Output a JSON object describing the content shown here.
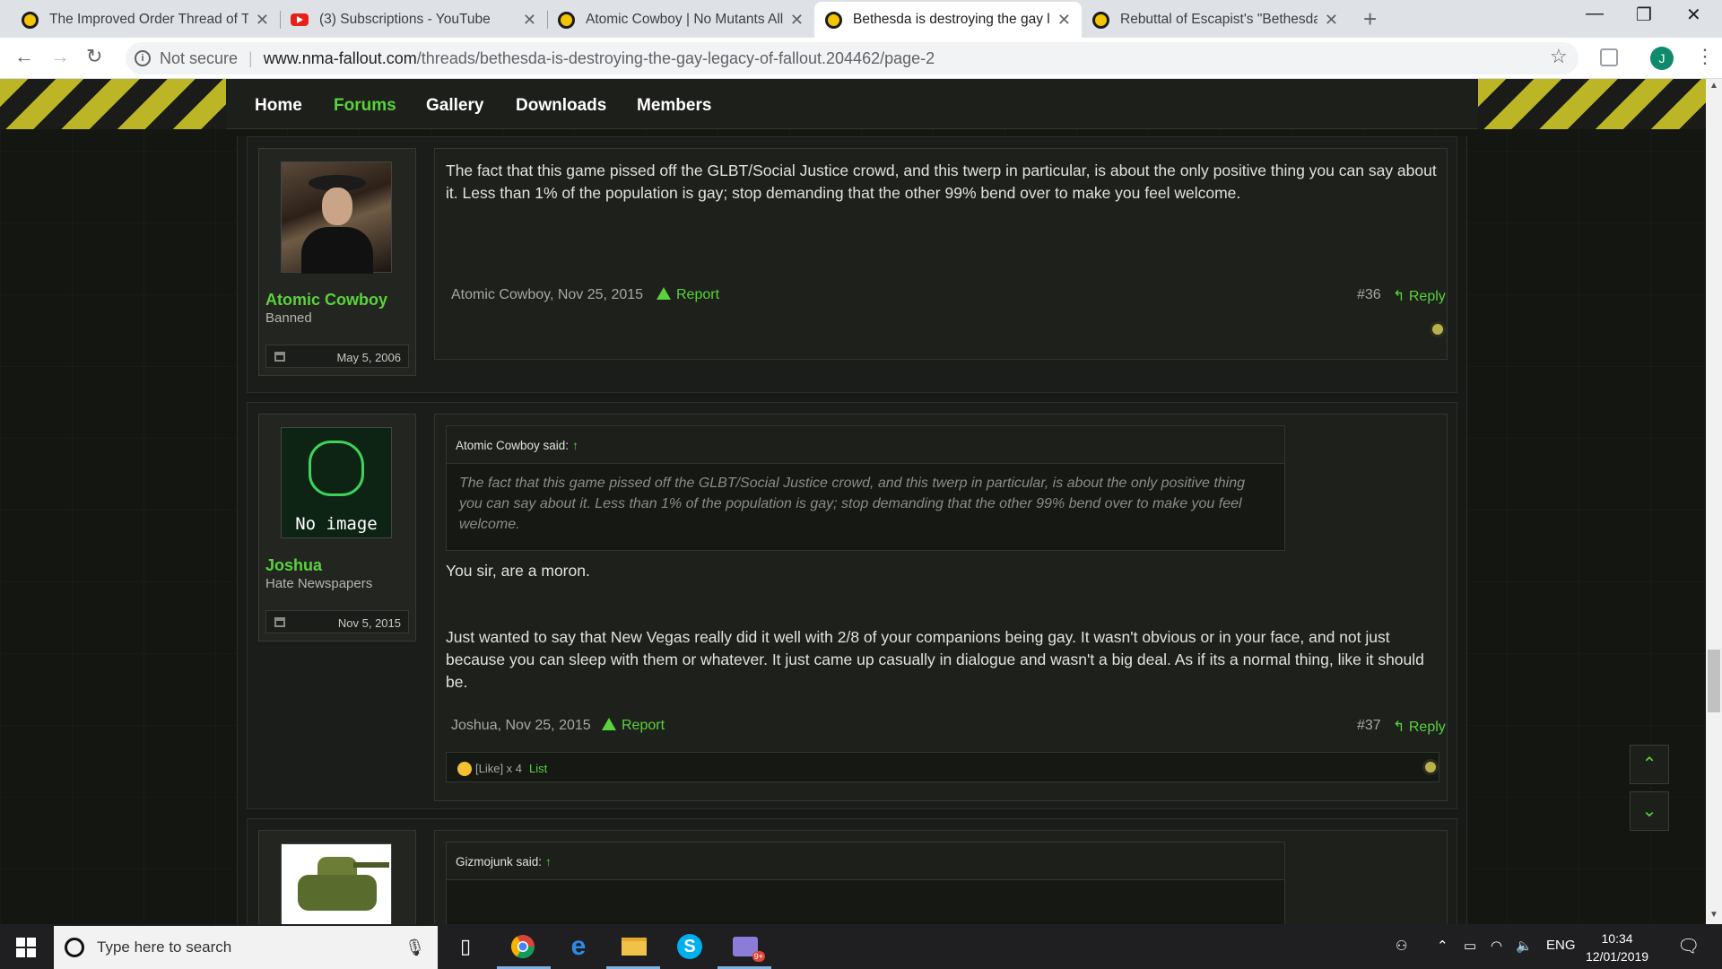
{
  "browser": {
    "tabs": [
      {
        "title": "The Improved Order Thread of Ti",
        "icon": "nma-favicon"
      },
      {
        "title": "(3) Subscriptions - YouTube",
        "icon": "youtube-favicon"
      },
      {
        "title": "Atomic Cowboy | No Mutants All",
        "icon": "nma-favicon"
      },
      {
        "title": "Bethesda is destroying the gay le",
        "icon": "nma-favicon",
        "active": true
      },
      {
        "title": "Rebuttal of Escapist's \"Bethesda i",
        "icon": "nma-favicon"
      }
    ],
    "address": {
      "security": "Not secure",
      "host": "www.nma-fallout.com",
      "path": "/threads/bethesda-is-destroying-the-gay-legacy-of-fallout.204462/page-2"
    },
    "profile_initial": "J"
  },
  "site": {
    "nav": [
      "Home",
      "Forums",
      "Gallery",
      "Downloads",
      "Members"
    ],
    "active_nav": "Forums"
  },
  "posts": [
    {
      "author": "Atomic Cowboy",
      "user_title": "Banned",
      "join_date": "May 5, 2006",
      "avatar": "photo",
      "body": "The fact that this game pissed off the GLBT/Social Justice crowd, and this twerp in particular, is about the only positive thing you can say about it. Less than 1% of the population is gay; stop demanding that the other 99% bend over to make you feel welcome.",
      "meta": "Atomic Cowboy, Nov 25, 2015",
      "report": "Report",
      "number": "#36",
      "reply": "Reply"
    },
    {
      "author": "Joshua",
      "user_title": "Hate Newspapers",
      "join_date": "Nov 5, 2015",
      "avatar": "no-image",
      "avatar_text": "No image",
      "quote_author": "Atomic Cowboy said:",
      "quote_arrow": "↑",
      "quote": "The fact that this game pissed off the GLBT/Social Justice crowd, and this twerp in particular, is about the only positive thing you can say about it. Less than 1% of the population is gay; stop demanding that the other 99% bend over to make you feel welcome.",
      "body1": "You sir, are a moron.",
      "body2": "Just wanted to say that New Vegas really did it well with 2/8 of your companions being gay. It wasn't obvious or in your face, and not just because you can sleep with them or whatever. It just came up casually in dialogue and wasn't a big deal. As if its a normal thing, like it should be.",
      "meta": "Joshua, Nov 25, 2015",
      "report": "Report",
      "number": "#37",
      "reply": "Reply",
      "likes": "[Like] x 4",
      "likes_list": "List"
    },
    {
      "avatar": "tank",
      "quote_author": "Gizmojunk said:",
      "quote_arrow": "↑"
    }
  ],
  "taskbar": {
    "search_placeholder": "Type here to search",
    "language": "ENG",
    "time": "10:34",
    "date": "12/01/2019",
    "mail_badge": "9+"
  },
  "colors": {
    "accent": "#5ad23c",
    "background": "#141612"
  }
}
